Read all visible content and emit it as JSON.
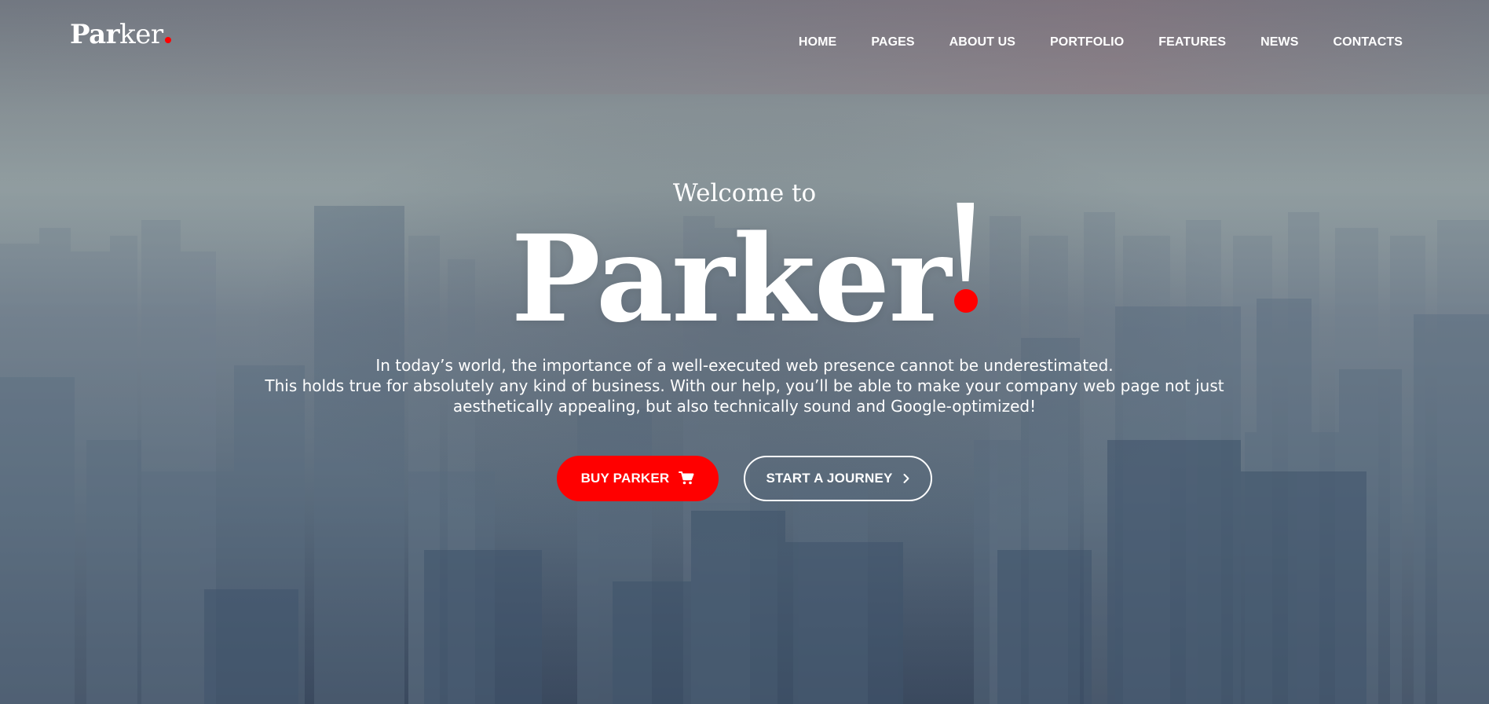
{
  "brand": {
    "logo_bold": "Par",
    "logo_light": "ker",
    "accent_color": "#ff0000"
  },
  "nav": {
    "items": [
      {
        "label": "HOME"
      },
      {
        "label": "PAGES"
      },
      {
        "label": "ABOUT US"
      },
      {
        "label": "PORTFOLIO"
      },
      {
        "label": "FEATURES"
      },
      {
        "label": "NEWS"
      },
      {
        "label": "CONTACTS"
      }
    ]
  },
  "hero": {
    "welcome": "Welcome to",
    "title": "Parker",
    "intro_line_1": "In today’s world, the importance of a well-executed web presence cannot be underestimated.",
    "intro_line_2": "This holds true for absolutely any kind of business. With our help, you’ll be able to make your company web page not just",
    "intro_line_3": "aesthetically appealing, but also technically sound and Google-optimized!",
    "buy_label": "BUY PARKER",
    "buy_icon": "shopping-cart-icon",
    "journey_label": "START A JOURNEY",
    "journey_icon": "chevron-right-icon"
  }
}
